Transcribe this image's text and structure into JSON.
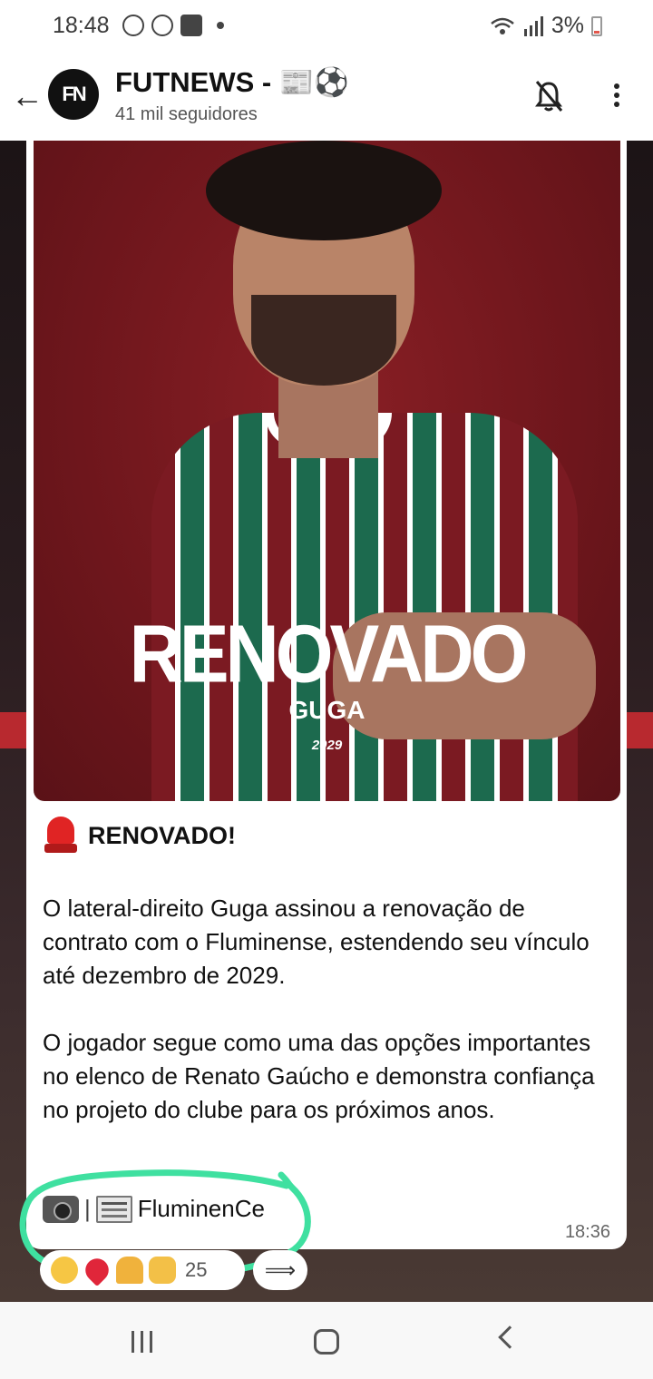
{
  "status_bar": {
    "time": "18:48",
    "battery": "3%",
    "icons_left": [
      "whatsapp-icon",
      "sync-icon",
      "key-icon",
      "dot-icon"
    ],
    "icons_right": [
      "wifi-icon",
      "signal-icon",
      "battery-icon"
    ]
  },
  "header": {
    "avatar_text": "FN",
    "title": "FUTNEWS - 📰⚽",
    "subtitle": "41 mil seguidores"
  },
  "post": {
    "poster": {
      "title": "RENOVADO",
      "name": "GUGA",
      "year": "2029"
    },
    "headline": "RENOVADO!",
    "paragraphs": [
      "O lateral-direito Guga assinou a renovação de contrato com o Fluminense, estendendo seu vínculo até dezembro de 2029.",
      "O jogador segue como uma das opções importantes no elenco de Renato Gaúcho e demonstra confiança no projeto do clube para os próximos anos."
    ],
    "signature_sep": "|",
    "signature": "FluminenCe",
    "time": "18:36"
  },
  "reactions": {
    "emojis": [
      "laugh-emoji",
      "heart-emoji",
      "pray-emoji",
      "thumbs-up-emoji"
    ],
    "count": "25"
  },
  "colors": {
    "poster_bg": "#7b1a22",
    "highlight": "#3fe0a0",
    "siren": "#e02424"
  }
}
